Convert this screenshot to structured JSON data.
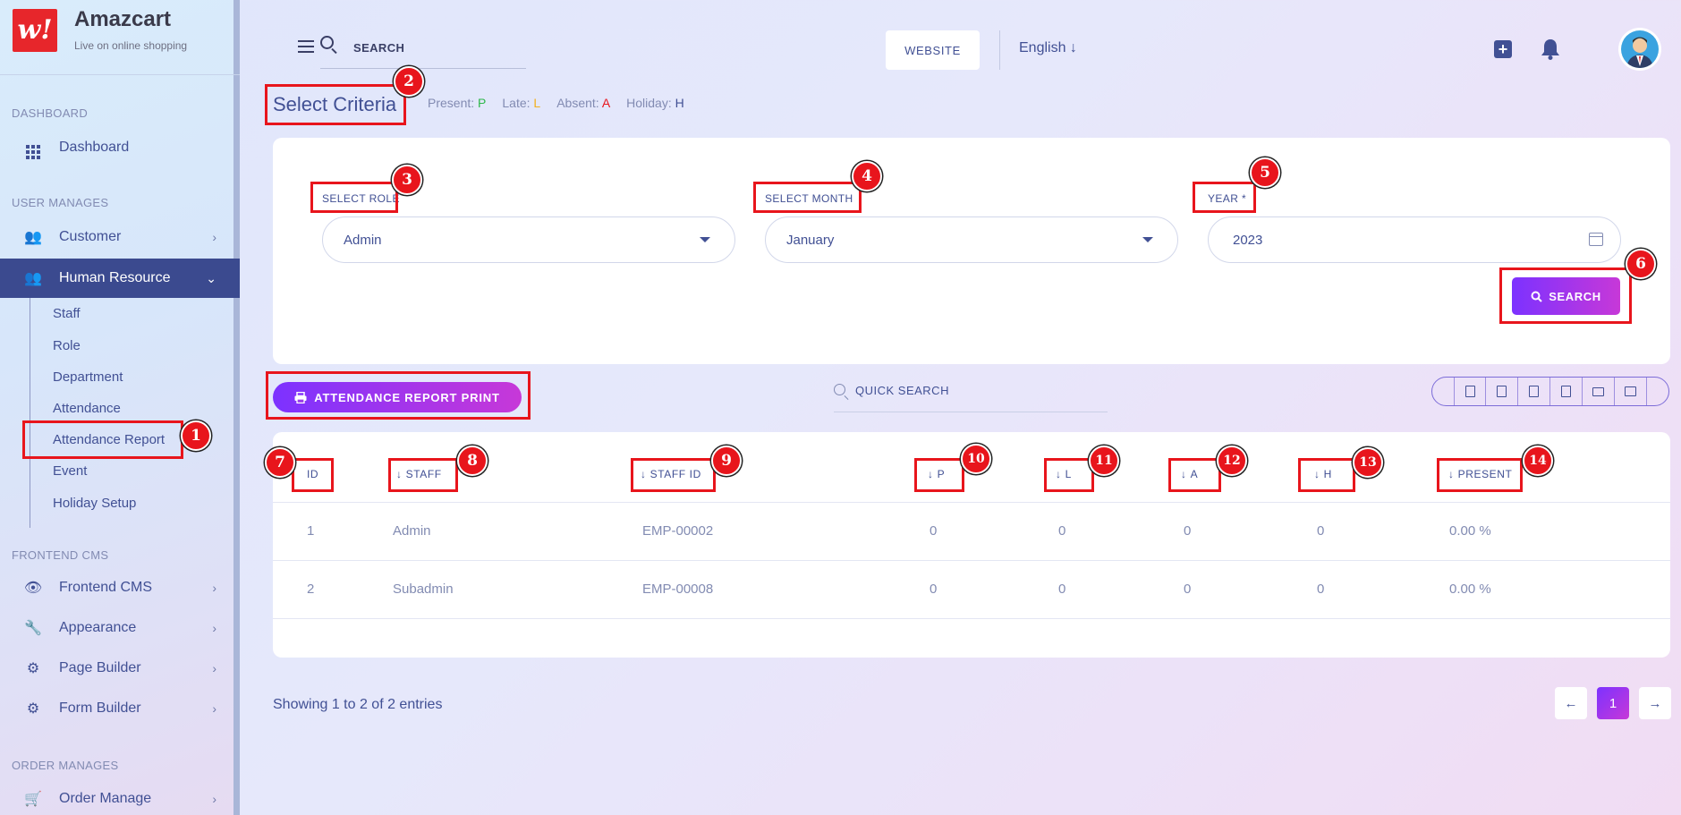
{
  "brand": {
    "name": "Amazcart",
    "tagline": "Live on online shopping",
    "logo_glyph": "w!"
  },
  "sidebar": {
    "sections": [
      {
        "title": "DASHBOARD"
      },
      {
        "title": "USER MANAGES"
      },
      {
        "title": "FRONTEND CMS"
      },
      {
        "title": "ORDER MANAGES"
      }
    ],
    "items": [
      {
        "label": "Dashboard",
        "icon": "grid-icon"
      },
      {
        "label": "Customer",
        "icon": "users-icon"
      },
      {
        "label": "Human Resource",
        "icon": "users-icon",
        "active": true
      },
      {
        "label": "Frontend CMS",
        "icon": "eye-icon"
      },
      {
        "label": "Appearance",
        "icon": "wrench-icon"
      },
      {
        "label": "Page Builder",
        "icon": "cogs-icon"
      },
      {
        "label": "Form Builder",
        "icon": "cogs-icon"
      },
      {
        "label": "Order Manage",
        "icon": "cart-icon"
      }
    ],
    "sub_items": [
      "Staff",
      "Role",
      "Department",
      "Attendance",
      "Attendance Report",
      "Event",
      "Holiday Setup"
    ]
  },
  "topbar": {
    "search_placeholder": "SEARCH",
    "website_label": "WEBSITE",
    "language": "English ↓"
  },
  "criteria": {
    "title": "Select Criteria",
    "legend": [
      {
        "label": "Present:",
        "code": "P",
        "color": "#2fb84c"
      },
      {
        "label": "Late:",
        "code": "L",
        "color": "#f2b01e"
      },
      {
        "label": "Absent:",
        "code": "A",
        "color": "#e8151c"
      },
      {
        "label": "Holiday:",
        "code": "H",
        "color": "#415094"
      }
    ],
    "role_label": "SELECT ROLE",
    "role_value": "Admin",
    "month_label": "SELECT MONTH",
    "month_value": "January",
    "year_label": "YEAR *",
    "year_value": "2023",
    "search_label": "SEARCH"
  },
  "report": {
    "print_label": "ATTENDANCE REPORT PRINT",
    "quick_search": "QUICK SEARCH",
    "tools": [
      "copy-icon",
      "excel-icon",
      "csv-icon",
      "pdf-icon",
      "print-icon",
      "columns-icon"
    ]
  },
  "table": {
    "headers": [
      "ID",
      "STAFF",
      "STAFF ID",
      "P",
      "L",
      "A",
      "H",
      "PRESENT"
    ],
    "rows": [
      [
        "1",
        "Admin",
        "EMP-00002",
        "0",
        "0",
        "0",
        "0",
        "0.00 %"
      ],
      [
        "2",
        "Subadmin",
        "EMP-00008",
        "0",
        "0",
        "0",
        "0",
        "0.00 %"
      ]
    ]
  },
  "footer": {
    "showing": "Showing 1 to 2 of 2 entries",
    "prev": "←",
    "page": "1",
    "next": "→"
  },
  "annotations": [
    "1",
    "2",
    "3",
    "4",
    "5",
    "6",
    "7",
    "8",
    "9",
    "10",
    "11",
    "12",
    "13",
    "14"
  ]
}
